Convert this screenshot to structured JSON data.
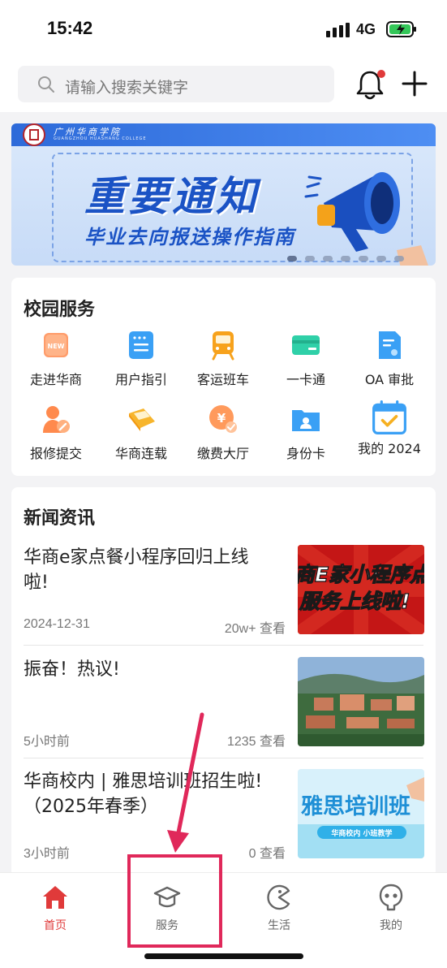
{
  "status": {
    "time": "15:42",
    "network": "4G"
  },
  "search": {
    "placeholder": "请输入搜索关键字"
  },
  "banner": {
    "school": "广州华商学院",
    "school_en": "GUANGZHOU HUASHANG COLLEGE",
    "title": "重要通知",
    "subtitle": "毕业去向报送操作指南"
  },
  "services": {
    "title": "校园服务",
    "items": [
      {
        "label": "走进华商",
        "icon": "new-badge-icon",
        "badge": "NEW"
      },
      {
        "label": "用户指引",
        "icon": "guide-icon"
      },
      {
        "label": "客运班车",
        "icon": "train-icon"
      },
      {
        "label": "一卡通",
        "icon": "card-icon"
      },
      {
        "label": "OA 审批",
        "icon": "approval-doc-icon"
      },
      {
        "label": "报修提交",
        "icon": "repair-icon"
      },
      {
        "label": "华商连载",
        "icon": "book-icon"
      },
      {
        "label": "缴费大厅",
        "icon": "payment-icon",
        "badge": "¥"
      },
      {
        "label": "身份卡",
        "icon": "id-folder-icon"
      },
      {
        "label": "我的 2024",
        "icon": "calendar-icon"
      }
    ]
  },
  "news": {
    "title": "新闻资讯",
    "items": [
      {
        "title": "华商e家点餐小程序回归上线啦!",
        "date": "2024-12-31",
        "views": "20w+ 查看",
        "thumb_text_1": "商E家小程序点",
        "thumb_text_2": "服务上线啦!"
      },
      {
        "title": "振奋！热议!",
        "date": "5小时前",
        "views": "1235 查看"
      },
      {
        "title": "华商校内 | 雅思培训班招生啦!（2025年春季）",
        "date": "3小时前",
        "views": "0 查看",
        "thumb_text_1": "雅思培训班",
        "thumb_text_2": "华商校内 小班教学"
      }
    ]
  },
  "tabbar": {
    "tabs": [
      {
        "label": "首页",
        "icon": "home-icon",
        "active": true
      },
      {
        "label": "服务",
        "icon": "graduation-cap-icon"
      },
      {
        "label": "生活",
        "icon": "pacman-icon"
      },
      {
        "label": "我的",
        "icon": "smiley-icon"
      }
    ]
  },
  "colors": {
    "accent": "#e03a3a",
    "annotation": "#e0285a",
    "banner_blue": "#1b53c5"
  }
}
